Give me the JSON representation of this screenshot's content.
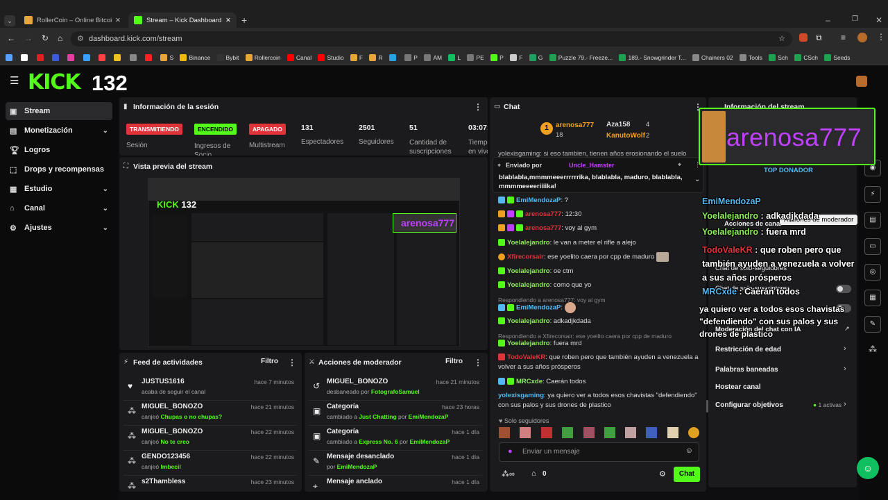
{
  "browser": {
    "tabs": [
      {
        "title": "RollerCoin – Online Bitcoin Mini"
      },
      {
        "title": "Stream – Kick Dashboard"
      }
    ],
    "url": "dashboard.kick.com/stream",
    "bookmarks": [
      "S",
      "Binance",
      "Bybit",
      "Rollercoin",
      "Canal",
      "Studio",
      "F",
      "R",
      "P",
      "AM",
      "L",
      "PE",
      "P",
      "F",
      "G",
      "Puzzle 79.- Freeze...",
      "189.- Snowgrinder T...",
      "Chainers 02",
      "Tools",
      "Sch",
      "CSch",
      "Seeds"
    ]
  },
  "kick": {
    "logo": "KICK",
    "viewer_count": "132"
  },
  "sidebar": [
    {
      "label": "Stream",
      "icon": "stream-icon"
    },
    {
      "label": "Monetización",
      "icon": "monetization-icon"
    },
    {
      "label": "Logros",
      "icon": "trophy-icon"
    },
    {
      "label": "Drops y recompensas",
      "icon": "drops-icon"
    },
    {
      "label": "Estudio",
      "icon": "studio-icon"
    },
    {
      "label": "Canal",
      "icon": "channel-icon"
    },
    {
      "label": "Ajustes",
      "icon": "gear-icon"
    }
  ],
  "session": {
    "title": "Información de la sesión",
    "badges": [
      {
        "text": "TRANSMITIENDO",
        "label": "Sesión"
      },
      {
        "text": "ENCENDIDO",
        "label": "Ingresos de Socio"
      },
      {
        "text": "APAGADO",
        "label": "Multistream"
      }
    ],
    "stats": [
      {
        "value": "131",
        "label": "Espectadores"
      },
      {
        "value": "2501",
        "label": "Seguidores"
      },
      {
        "value": "51",
        "label": "Cantidad de suscripciones"
      },
      {
        "value": "03:07:",
        "label": "Tiempo en vivo"
      }
    ]
  },
  "preview": {
    "title": "Vista previa del stream"
  },
  "feed": {
    "title": "Feed de actividades",
    "filter": "Filtro",
    "items": [
      {
        "name": "JUSTUS1616",
        "time": "hace 7 minutos",
        "desc": "acaba de seguir el canal",
        "extra": ""
      },
      {
        "name": "MIGUEL_BONOZO",
        "time": "hace 21 minutos",
        "desc": "canjeó",
        "extra": "Chupas o no chupas?"
      },
      {
        "name": "MIGUEL_BONOZO",
        "time": "hace 22 minutos",
        "desc": "canjeó",
        "extra": "No te creo"
      },
      {
        "name": "GENDO123456",
        "time": "hace 22 minutos",
        "desc": "canjeó",
        "extra": "Imbecil"
      },
      {
        "name": "s2Thambless",
        "time": "hace 23 minutos",
        "desc": "",
        "extra": ""
      }
    ]
  },
  "mod": {
    "title": "Acciones de moderador",
    "filter": "Filtro",
    "items": [
      {
        "name": "MIGUEL_BONOZO",
        "time": "hace 21 minutos",
        "desc": "desbaneado por",
        "extra": "FotografoSamuel",
        "extra2": ""
      },
      {
        "name": "Categoría",
        "time": "hace 23 horas",
        "desc": "cambiado a",
        "extra": "Just Chatting",
        "extra2": "EmiMendozaP"
      },
      {
        "name": "Categoría",
        "time": "hace 1 día",
        "desc": "cambiado a",
        "extra": "Express No. 6",
        "extra2": "EmiMendozaP"
      },
      {
        "name": "Mensaje desanclado",
        "time": "hace 1 día",
        "desc": "por",
        "extra": "EmiMendozaP",
        "extra2": ""
      },
      {
        "name": "Mensaje anclado",
        "time": "hace 1 día",
        "desc": "",
        "extra": "",
        "extra2": ""
      }
    ]
  },
  "chat": {
    "title": "Chat",
    "top": [
      {
        "name": "arenosa777",
        "v1": "18"
      },
      {
        "name": "Aza158",
        "v1": "4"
      },
      {
        "name": "KanutoWolf",
        "v1": "2"
      }
    ],
    "scroll_partial": "yolexisgaming: si eso tambien, tienen años erosionando el suelo",
    "pinned_by": "Enviado por",
    "pinned_user": "Uncle_Hamster",
    "pinned_text": "blablabla,mmmmeeerrrrrrika, blablabla, maduro, blablabla, mmmmeeeeriiiika!",
    "messages": [
      {
        "user": "EmiMendozaP",
        "text": "?",
        "color": "#53b8f0",
        "reply": ""
      },
      {
        "user": "arenosa777",
        "text": "12:30",
        "color": "#e0343a",
        "reply": ""
      },
      {
        "user": "arenosa777",
        "text": "voy al gym",
        "color": "#e0343a",
        "reply": ""
      },
      {
        "user": "Yoelalejandro",
        "text": "le van a meter el rifle a alejo",
        "color": "#8cf05a",
        "reply": ""
      },
      {
        "user": "Xfirecorsair",
        "text": "ese yoelito caera por cpp de maduro",
        "color": "#e0343a",
        "reply": ""
      },
      {
        "user": "Yoelalejandro",
        "text": "oe ctm",
        "color": "#8cf05a",
        "reply": ""
      },
      {
        "user": "Yoelalejandro",
        "text": "como que yo",
        "color": "#8cf05a",
        "reply": ""
      },
      {
        "user": "EmiMendozaP",
        "text": "",
        "color": "#53b8f0",
        "reply": "Respondiendo a arenosa777: voy al gym"
      },
      {
        "user": "Yoelalejandro",
        "text": "adkadjkdada",
        "color": "#8cf05a",
        "reply": ""
      },
      {
        "user": "Yoelalejandro",
        "text": "fuera mrd",
        "color": "#8cf05a",
        "reply": "Respondiendo a Xfirecorsair: ese yoelito caera por cpp de maduro"
      },
      {
        "user": "TodoValeKR",
        "text": "que roben pero que también ayuden a venezuela a volver a sus años prósperos",
        "color": "#e0343a",
        "reply": ""
      },
      {
        "user": "MRCxde",
        "text": "Caerán todos",
        "color": "#8cf05a",
        "reply": ""
      },
      {
        "user": "yolexisgaming",
        "text": "ya quiero ver a todos esos chavistas \"defendiendo\" con sus palos y sus drones de plastico",
        "color": "#53b8f0",
        "reply": ""
      }
    ],
    "followers_only": "Solo seguidores",
    "input_placeholder": "Enviar un mensaje",
    "count": "0",
    "send": "Chat"
  },
  "streaminfo": {
    "title": "Información del stream",
    "overlay_name": "arenosa777",
    "overlay_label": "TOP DONADOR",
    "items": [
      "Acciones de canal",
      "Chat de solo-seguidores",
      "Chat de solo-suscriptores",
      "Moderación del chat con IA",
      "Restricción de edad",
      "Palabras baneadas",
      "Hostear canal",
      "Configurar objetivos"
    ],
    "goals": "1 activas",
    "tooltip": "Acciones de moderador"
  },
  "overlay_chat": [
    {
      "user": "EmiMendozaP",
      "text": ""
    },
    {
      "user": "Yoelalejandro",
      "text": "adkadjkdada"
    },
    {
      "user": "Yoelalejandro",
      "text": "fuera mrd"
    },
    {
      "user": "TodoValeKR",
      "text": "que roben pero que también ayuden a venezuela a volver a sus años prósperos"
    },
    {
      "user": "MRCxde",
      "text": "Caerán todos"
    },
    {
      "user": "",
      "text": "ya quiero ver a todos esos chavistas \"defendiendo\" con sus palos y sus drones de plastico"
    }
  ],
  "colors": {
    "kick_green": "#53fc18",
    "red": "#e0343a",
    "panel": "#1b1b1d",
    "overlay_purple": "#c040ff"
  }
}
